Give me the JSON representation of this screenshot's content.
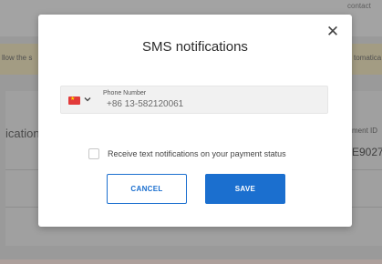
{
  "background": {
    "top_text": "contact",
    "banner_left": "llow the s",
    "banner_right": "tomatica",
    "section_label": "ication",
    "column_label": "ment ID",
    "column_value": "E9027"
  },
  "modal": {
    "title": "SMS notifications",
    "close_icon": "close-icon",
    "phone": {
      "country_flag": "china-flag-icon",
      "label": "Phone Number",
      "value": "+86 13-582120061"
    },
    "checkbox": {
      "label": "Receive text notifications on your payment status",
      "checked": false
    },
    "buttons": {
      "cancel_label": "CANCEL",
      "save_label": "SAVE"
    }
  },
  "colors": {
    "primary": "#1b6fcf",
    "overlay": "#9a9a9a",
    "flag_red": "#e23a3a"
  }
}
